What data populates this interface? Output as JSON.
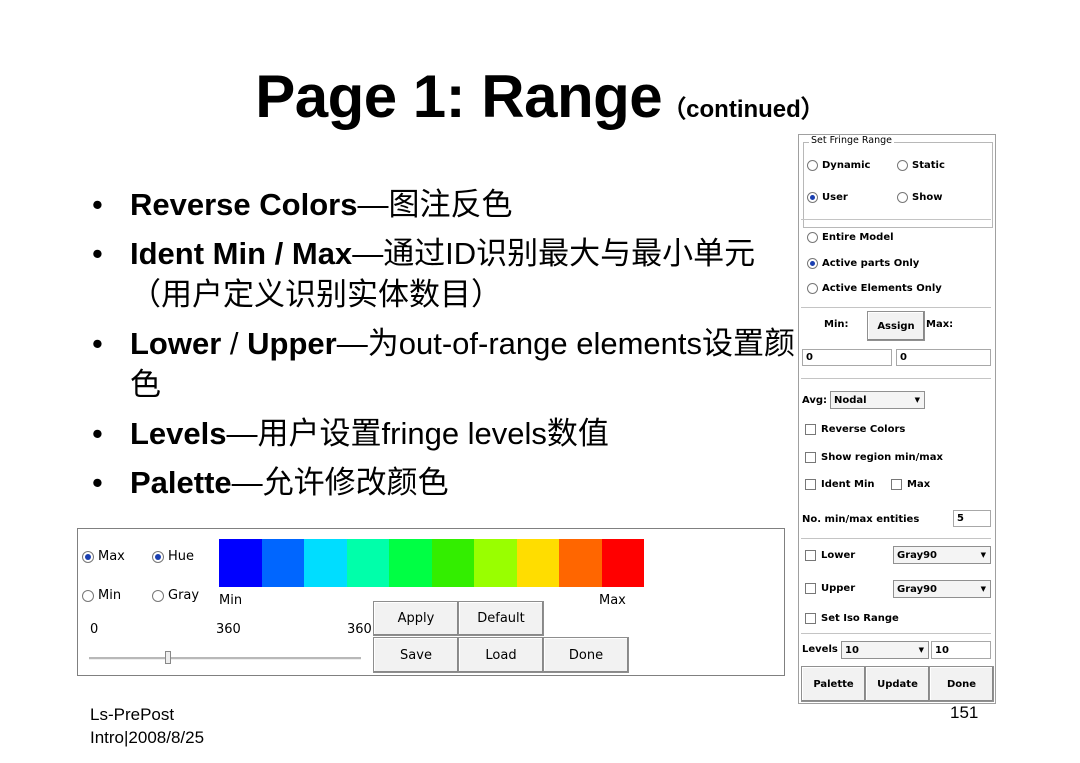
{
  "title": {
    "main": "Page 1: Range",
    "sub": "（continued）"
  },
  "bullets": [
    {
      "bold": "Reverse Colors",
      "text": "—图注反色"
    },
    {
      "bold": "Ident Min / Max",
      "text": "—通过ID识别最大与最小单元（用户定义识别实体数目）"
    },
    {
      "bold": "Lower",
      "mid": " / ",
      "bold2": "Upper",
      "text": "—为out-of-range elements设置颜色"
    },
    {
      "bold": "Levels",
      "text": "—用户设置fringe levels数值"
    },
    {
      "bold": "Palette",
      "text": "—允许修改颜色"
    }
  ],
  "footer": {
    "left_line1": "Ls-PrePost",
    "left_line2": "Intro|2008/8/25",
    "page": "151"
  },
  "right_panel": {
    "group_label": "Set Fringe Range",
    "dynamic": "Dynamic",
    "static": "Static",
    "user": "User",
    "show": "Show",
    "entire_model": "Entire Model",
    "active_parts_only": "Active parts Only",
    "active_elements_only": "Active Elements Only",
    "min_label": "Min:",
    "assign_button": "Assign",
    "max_label": "Max:",
    "min_value": "0",
    "max_value": "0",
    "avg_label": "Avg:",
    "avg_value": "Nodal",
    "reverse_colors": "Reverse Colors",
    "show_region": "Show region min/max",
    "ident_min": "Ident Min",
    "ident_max": "Max",
    "no_entities_label": "No. min/max entities",
    "no_entities_value": "5",
    "lower": "Lower",
    "lower_color": "Gray90",
    "upper": "Upper",
    "upper_color": "Gray90",
    "set_iso_range": "Set Iso Range",
    "levels_label": "Levels",
    "levels_select": "10",
    "levels_value": "10",
    "palette_button": "Palette",
    "update_button": "Update",
    "done_button": "Done"
  },
  "bottom_panel": {
    "max": "Max",
    "min": "Min",
    "hue": "Hue",
    "gray": "Gray",
    "scale_min": "Min",
    "scale_max": "Max",
    "value_0": "0",
    "value_360a": "360",
    "value_360b": "360",
    "apply_button": "Apply",
    "default_button": "Default",
    "save_button": "Save",
    "load_button": "Load",
    "done_button": "Done",
    "swatch_colors": [
      "#0000ff",
      "#0066ff",
      "#00ddff",
      "#00ffaa",
      "#00ff44",
      "#33ee00",
      "#99ff00",
      "#ffdd00",
      "#ff6600",
      "#ff0000"
    ]
  }
}
